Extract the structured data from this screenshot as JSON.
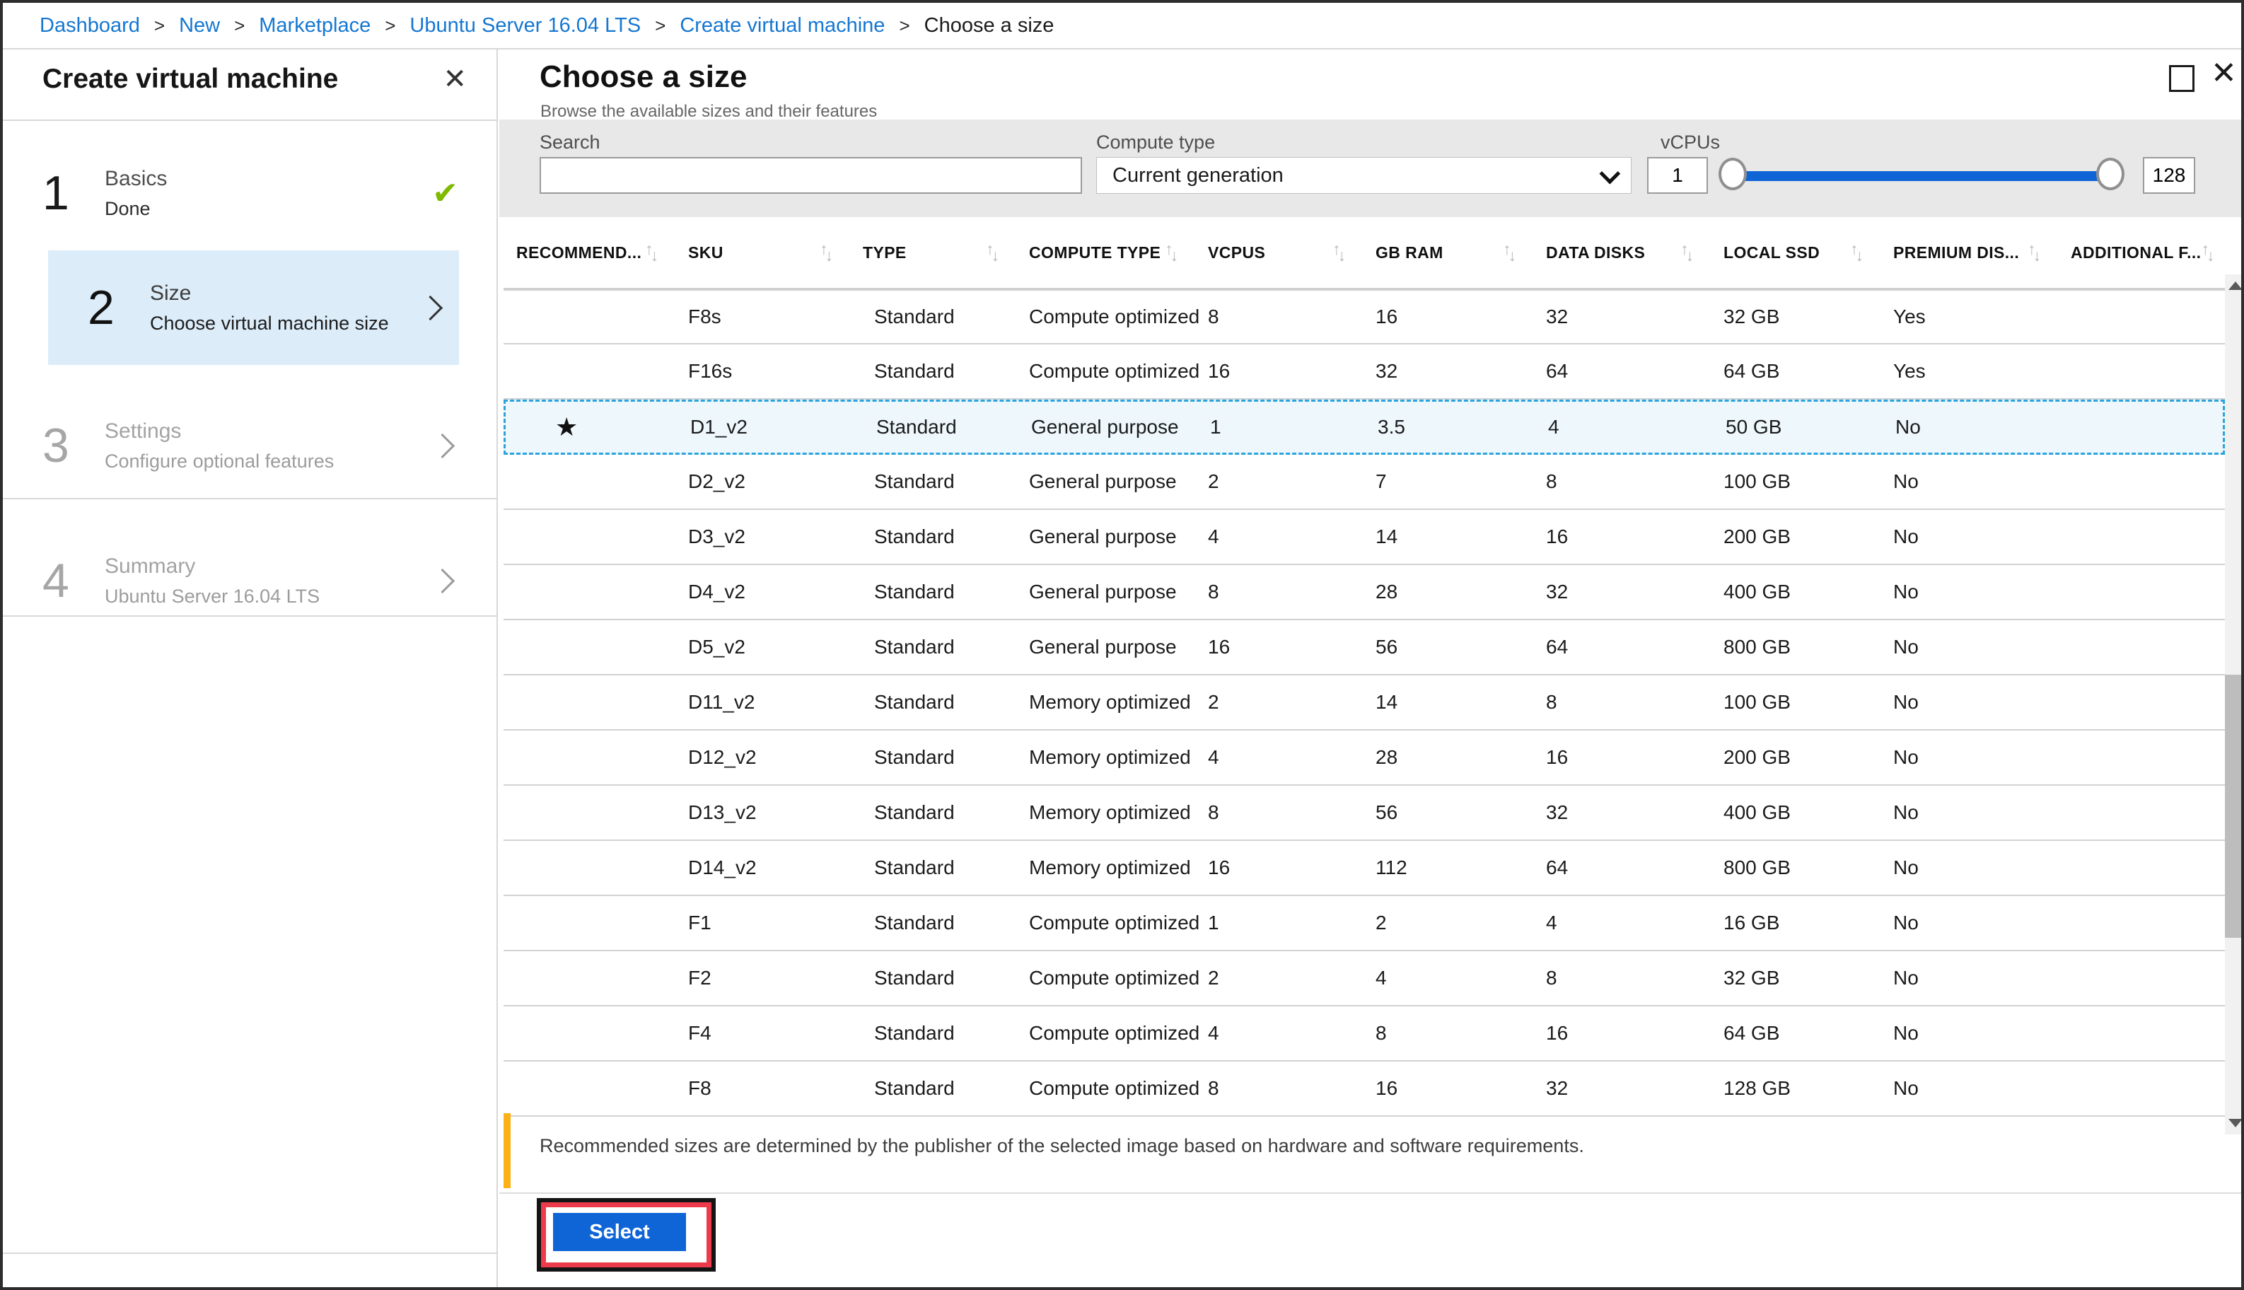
{
  "breadcrumb": {
    "separator": ">",
    "items": [
      {
        "label": "Dashboard",
        "current": false
      },
      {
        "label": "New",
        "current": false
      },
      {
        "label": "Marketplace",
        "current": false
      },
      {
        "label": "Ubuntu Server 16.04 LTS",
        "current": false
      },
      {
        "label": "Create virtual machine",
        "current": false
      },
      {
        "label": "Choose a size",
        "current": true
      }
    ]
  },
  "left_panel": {
    "title": "Create virtual machine",
    "close_icon": "✕",
    "steps": [
      {
        "number": "1",
        "label": "Basics",
        "sublabel": "Done",
        "state": "done",
        "check_icon": "✔"
      },
      {
        "number": "2",
        "label": "Size",
        "sublabel": "Choose virtual machine size",
        "state": "active"
      },
      {
        "number": "3",
        "label": "Settings",
        "sublabel": "Configure optional features",
        "state": "pending"
      },
      {
        "number": "4",
        "label": "Summary",
        "sublabel": "Ubuntu Server 16.04 LTS",
        "state": "pending"
      }
    ]
  },
  "blade": {
    "title": "Choose a size",
    "subtitle": "Browse the available sizes and their features",
    "maximize_icon": "maximize",
    "close_icon": "✕"
  },
  "filters": {
    "search_label": "Search",
    "search_value": "",
    "search_placeholder": "",
    "compute_type_label": "Compute type",
    "compute_type_value": "Current generation",
    "vcpus_label": "vCPUs",
    "vcpus_min": "1",
    "vcpus_max": "128"
  },
  "table": {
    "sort_up_icon": "↑",
    "sort_down_icon": "↓",
    "star_icon": "★",
    "columns": [
      {
        "id": "recommended",
        "label": "RECOMMEND..."
      },
      {
        "id": "sku",
        "label": "SKU"
      },
      {
        "id": "type",
        "label": "TYPE"
      },
      {
        "id": "compute_type",
        "label": "COMPUTE TYPE"
      },
      {
        "id": "vcpus",
        "label": "VCPUS"
      },
      {
        "id": "gb_ram",
        "label": "GB RAM"
      },
      {
        "id": "data_disks",
        "label": "DATA DISKS"
      },
      {
        "id": "local_ssd",
        "label": "LOCAL SSD"
      },
      {
        "id": "premium_disk",
        "label": "PREMIUM DIS..."
      },
      {
        "id": "additional",
        "label": "ADDITIONAL F..."
      }
    ],
    "rows": [
      {
        "recommended": false,
        "selected": false,
        "sku": "F8s",
        "type": "Standard",
        "compute_type": "Compute optimized",
        "vcpus": "8",
        "gb_ram": "16",
        "data_disks": "32",
        "local_ssd": "32 GB",
        "premium_disk": "Yes",
        "additional": ""
      },
      {
        "recommended": false,
        "selected": false,
        "sku": "F16s",
        "type": "Standard",
        "compute_type": "Compute optimized",
        "vcpus": "16",
        "gb_ram": "32",
        "data_disks": "64",
        "local_ssd": "64 GB",
        "premium_disk": "Yes",
        "additional": ""
      },
      {
        "recommended": true,
        "selected": true,
        "sku": "D1_v2",
        "type": "Standard",
        "compute_type": "General purpose",
        "vcpus": "1",
        "gb_ram": "3.5",
        "data_disks": "4",
        "local_ssd": "50 GB",
        "premium_disk": "No",
        "additional": ""
      },
      {
        "recommended": false,
        "selected": false,
        "sku": "D2_v2",
        "type": "Standard",
        "compute_type": "General purpose",
        "vcpus": "2",
        "gb_ram": "7",
        "data_disks": "8",
        "local_ssd": "100 GB",
        "premium_disk": "No",
        "additional": ""
      },
      {
        "recommended": false,
        "selected": false,
        "sku": "D3_v2",
        "type": "Standard",
        "compute_type": "General purpose",
        "vcpus": "4",
        "gb_ram": "14",
        "data_disks": "16",
        "local_ssd": "200 GB",
        "premium_disk": "No",
        "additional": ""
      },
      {
        "recommended": false,
        "selected": false,
        "sku": "D4_v2",
        "type": "Standard",
        "compute_type": "General purpose",
        "vcpus": "8",
        "gb_ram": "28",
        "data_disks": "32",
        "local_ssd": "400 GB",
        "premium_disk": "No",
        "additional": ""
      },
      {
        "recommended": false,
        "selected": false,
        "sku": "D5_v2",
        "type": "Standard",
        "compute_type": "General purpose",
        "vcpus": "16",
        "gb_ram": "56",
        "data_disks": "64",
        "local_ssd": "800 GB",
        "premium_disk": "No",
        "additional": ""
      },
      {
        "recommended": false,
        "selected": false,
        "sku": "D11_v2",
        "type": "Standard",
        "compute_type": "Memory optimized",
        "vcpus": "2",
        "gb_ram": "14",
        "data_disks": "8",
        "local_ssd": "100 GB",
        "premium_disk": "No",
        "additional": ""
      },
      {
        "recommended": false,
        "selected": false,
        "sku": "D12_v2",
        "type": "Standard",
        "compute_type": "Memory optimized",
        "vcpus": "4",
        "gb_ram": "28",
        "data_disks": "16",
        "local_ssd": "200 GB",
        "premium_disk": "No",
        "additional": ""
      },
      {
        "recommended": false,
        "selected": false,
        "sku": "D13_v2",
        "type": "Standard",
        "compute_type": "Memory optimized",
        "vcpus": "8",
        "gb_ram": "56",
        "data_disks": "32",
        "local_ssd": "400 GB",
        "premium_disk": "No",
        "additional": ""
      },
      {
        "recommended": false,
        "selected": false,
        "sku": "D14_v2",
        "type": "Standard",
        "compute_type": "Memory optimized",
        "vcpus": "16",
        "gb_ram": "112",
        "data_disks": "64",
        "local_ssd": "800 GB",
        "premium_disk": "No",
        "additional": ""
      },
      {
        "recommended": false,
        "selected": false,
        "sku": "F1",
        "type": "Standard",
        "compute_type": "Compute optimized",
        "vcpus": "1",
        "gb_ram": "2",
        "data_disks": "4",
        "local_ssd": "16 GB",
        "premium_disk": "No",
        "additional": ""
      },
      {
        "recommended": false,
        "selected": false,
        "sku": "F2",
        "type": "Standard",
        "compute_type": "Compute optimized",
        "vcpus": "2",
        "gb_ram": "4",
        "data_disks": "8",
        "local_ssd": "32 GB",
        "premium_disk": "No",
        "additional": ""
      },
      {
        "recommended": false,
        "selected": false,
        "sku": "F4",
        "type": "Standard",
        "compute_type": "Compute optimized",
        "vcpus": "4",
        "gb_ram": "8",
        "data_disks": "16",
        "local_ssd": "64 GB",
        "premium_disk": "No",
        "additional": ""
      },
      {
        "recommended": false,
        "selected": false,
        "sku": "F8",
        "type": "Standard",
        "compute_type": "Compute optimized",
        "vcpus": "8",
        "gb_ram": "16",
        "data_disks": "32",
        "local_ssd": "128 GB",
        "premium_disk": "No",
        "additional": ""
      }
    ]
  },
  "note": {
    "text": "Recommended sizes are determined by the publisher of the selected image based on hardware and software requirements."
  },
  "footer": {
    "select_label": "Select"
  },
  "colors": {
    "accent_blue": "#1065d6",
    "link_blue": "#1577d1",
    "active_step_bg": "#dcecf9",
    "selected_row_bg": "#edf7fc",
    "selected_row_border": "#2ba4dd",
    "done_green": "#7fba00",
    "note_yellow": "#fcb117",
    "annotation_red": "#ee3b4b",
    "filter_bar_gray": "#e8e8e8"
  }
}
